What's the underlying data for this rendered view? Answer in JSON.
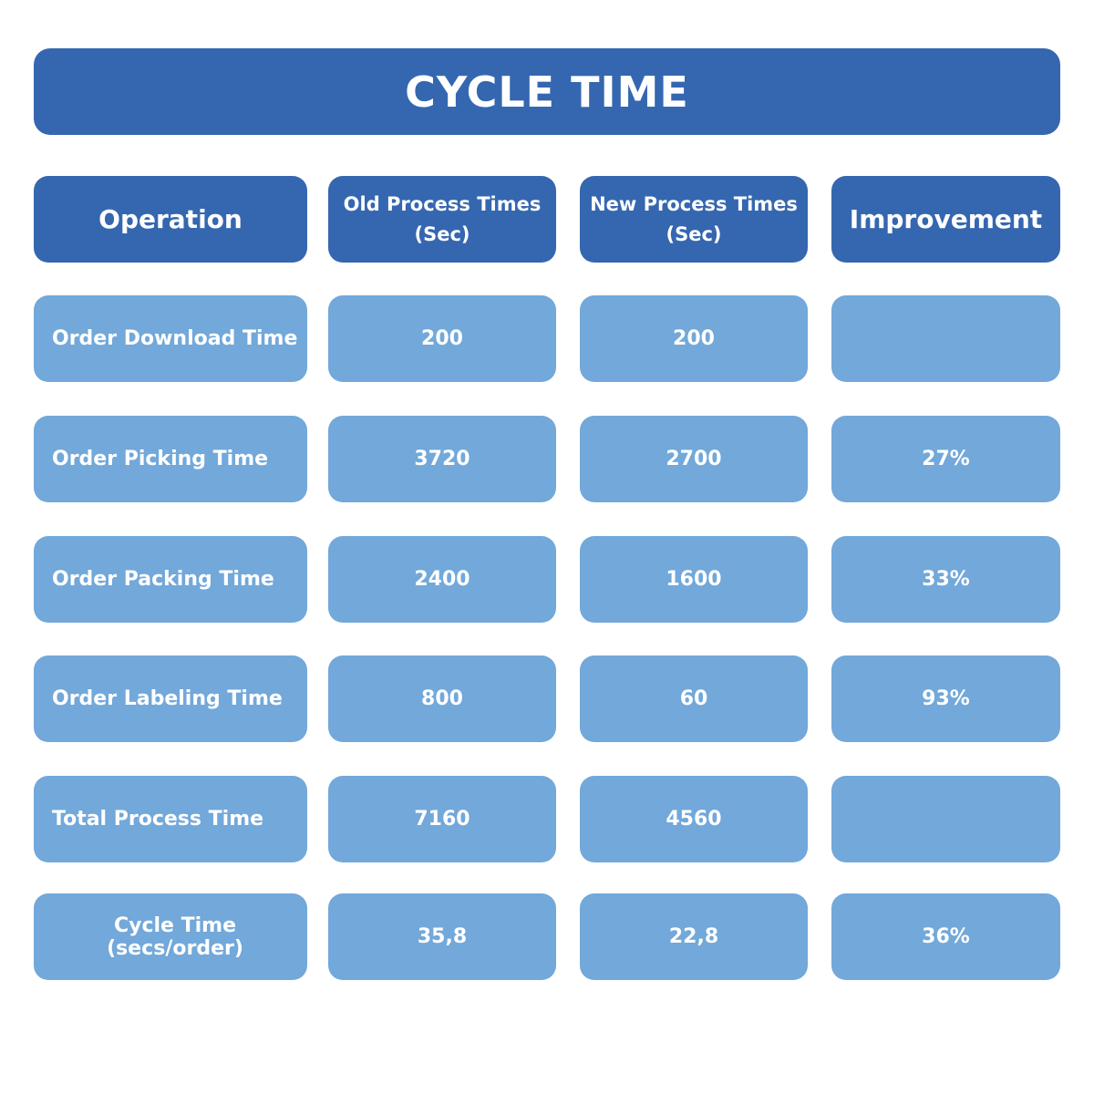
{
  "title": "CYCLE TIME",
  "colors": {
    "header": "#3567B0",
    "cell": "#72A8DA",
    "text": "#FFFFFF"
  },
  "headers": {
    "operation": "Operation",
    "old_line1": "Old Process Times",
    "old_line2": "(Sec)",
    "new_line1": "New Process Times",
    "new_line2": "(Sec)",
    "improvement": "Improvement"
  },
  "rows": [
    {
      "operation": "Order Download Time",
      "old": "200",
      "new": "200",
      "improvement": ""
    },
    {
      "operation": "Order Picking Time",
      "old": "3720",
      "new": "2700",
      "improvement": "27%"
    },
    {
      "operation": "Order Packing Time",
      "old": "2400",
      "new": "1600",
      "improvement": "33%"
    },
    {
      "operation": "Order Labeling Time",
      "old": "800",
      "new": "60",
      "improvement": "93%"
    },
    {
      "operation": "Total Process Time",
      "old": "7160",
      "new": "4560",
      "improvement": ""
    },
    {
      "operation": "Cycle Time (secs/order)",
      "old": "35,8",
      "new": "22,8",
      "improvement": "36%"
    }
  ]
}
